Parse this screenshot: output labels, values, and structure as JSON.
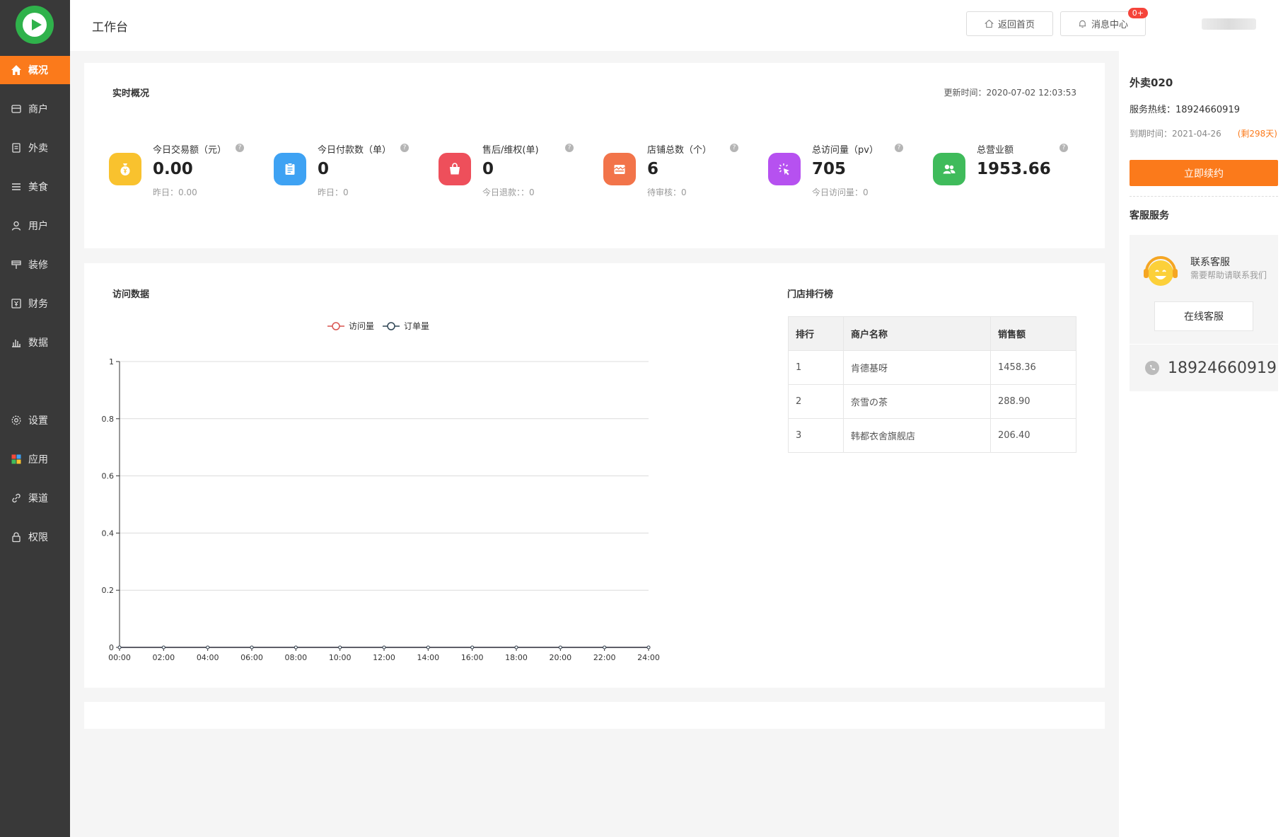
{
  "sidebar": {
    "items": [
      {
        "label": "概况",
        "icon": "home-icon"
      },
      {
        "label": "商户",
        "icon": "store-icon"
      },
      {
        "label": "外卖",
        "icon": "document-icon"
      },
      {
        "label": "美食",
        "icon": "menu-lines-icon"
      },
      {
        "label": "用户",
        "icon": "user-icon"
      },
      {
        "label": "装修",
        "icon": "brush-icon"
      },
      {
        "label": "财务",
        "icon": "yuan-icon"
      },
      {
        "label": "数据",
        "icon": "bar-chart-icon"
      },
      {
        "label": "设置",
        "icon": "gear-icon"
      },
      {
        "label": "应用",
        "icon": "apps-icon"
      },
      {
        "label": "渠道",
        "icon": "link-icon"
      },
      {
        "label": "权限",
        "icon": "lock-icon"
      }
    ]
  },
  "header": {
    "title": "工作台",
    "home_button": "返回首页",
    "message_button": "消息中心",
    "message_badge": "0+"
  },
  "overview": {
    "title": "实时概况",
    "update_time": "更新时间：2020-07-02 12:03:53",
    "stats": [
      {
        "label": "今日交易额（元）",
        "value": "0.00",
        "sub": "昨日：0.00",
        "color": "#f9c22e",
        "icon": "money-bag-icon"
      },
      {
        "label": "今日付款数（单）",
        "value": "0",
        "sub": "昨日：0",
        "color": "#3ea2f3",
        "icon": "clipboard-icon"
      },
      {
        "label": "售后/维权(单)",
        "value": "0",
        "sub": "今日退款：：0",
        "color": "#ee4f5b",
        "icon": "shopping-bag-icon"
      },
      {
        "label": "店铺总数（个）",
        "value": "6",
        "sub": "待审核：0",
        "color": "#f2744a",
        "icon": "storefront-icon"
      },
      {
        "label": "总访问量（pv）",
        "value": "705",
        "sub": "今日访问量：0",
        "color": "#b651f0",
        "icon": "click-icon"
      },
      {
        "label": "总营业额",
        "value": "1953.66",
        "sub": "",
        "color": "#3fbb5b",
        "icon": "users-icon"
      }
    ]
  },
  "visits": {
    "title": "访问数据"
  },
  "chart_data": {
    "type": "line",
    "x": [
      "00:00",
      "02:00",
      "04:00",
      "06:00",
      "08:00",
      "10:00",
      "12:00",
      "14:00",
      "16:00",
      "18:00",
      "20:00",
      "22:00",
      "24:00"
    ],
    "series": [
      {
        "name": "访问量",
        "color": "#d9534f",
        "values": [
          0,
          0,
          0,
          0,
          0,
          0,
          0,
          0,
          0,
          0,
          0,
          0,
          0
        ]
      },
      {
        "name": "订单量",
        "color": "#2f4554",
        "values": [
          0,
          0,
          0,
          0,
          0,
          0,
          0,
          0,
          0,
          0,
          0,
          0,
          0
        ]
      }
    ],
    "ylim": [
      0,
      1
    ],
    "yticks": [
      "0",
      "0.2",
      "0.4",
      "0.6",
      "0.8",
      "1"
    ],
    "grid": true,
    "legend": "top-center"
  },
  "ranking": {
    "title": "门店排行榜",
    "headers": [
      "排行",
      "商户名称",
      "销售额"
    ],
    "rows": [
      [
        "1",
        "肯德基呀",
        "1458.36"
      ],
      [
        "2",
        "奈雪の茶",
        "288.90"
      ],
      [
        "3",
        "韩都衣舍旗舰店",
        "206.40"
      ]
    ]
  },
  "right": {
    "shop_name": "外卖020",
    "hotline": "服务热线：18924660919",
    "expire": "到期时间：2021-04-26",
    "remain": "(剩298天)",
    "renew_button": "立即续约",
    "service_title": "客服服务",
    "service_name": "联系客服",
    "service_desc": "需要帮助请联系我们",
    "online_button": "在线客服",
    "phone": "18924660919"
  }
}
